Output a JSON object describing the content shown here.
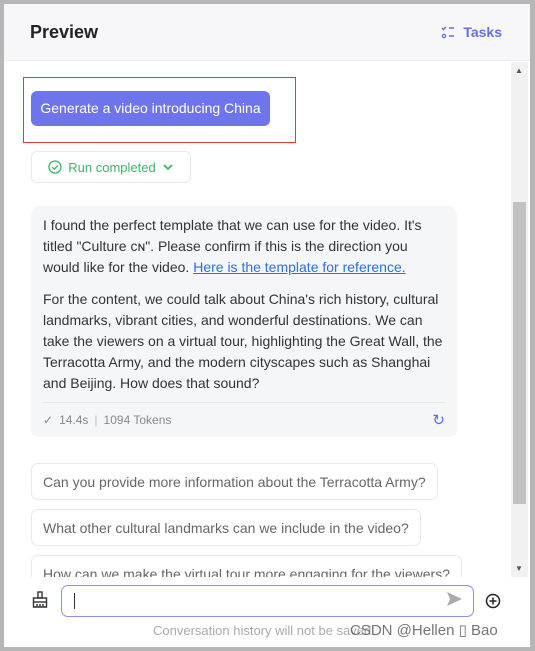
{
  "header": {
    "title": "Preview",
    "tasks_label": "Tasks"
  },
  "user_message": "Generate a video introducing China",
  "run_status": "Run completed",
  "reply": {
    "p1": "I found the perfect template that we can use for the video. It's titled \"Culture ᴄɴ\". Please confirm if this is the direction you would like for the video. ",
    "link": "Here is the template for reference.",
    "p2": "For the content, we could talk about China's rich history, cultural landmarks, vibrant cities, and wonderful destinations. We can take the viewers on a virtual tour, highlighting the Great Wall, the Terracotta Army, and the modern cityscapes such as Shanghai and Beijing. How does that sound?",
    "time": "14.4s",
    "tokens": "1094 Tokens"
  },
  "suggestions": [
    "Can you provide more information about the Terracotta Army?",
    "What other cultural landmarks can we include in the video?",
    "How can we make the virtual tour more engaging for the viewers?"
  ],
  "input": {
    "value": ""
  },
  "footer": "Conversation history will not be saved",
  "watermark": "CSDN @Hellen ▯ Bao",
  "colors": {
    "accent": "#6e74ec",
    "success": "#3ab56a",
    "link": "#2e6fe0",
    "highlight": "#e53935"
  }
}
